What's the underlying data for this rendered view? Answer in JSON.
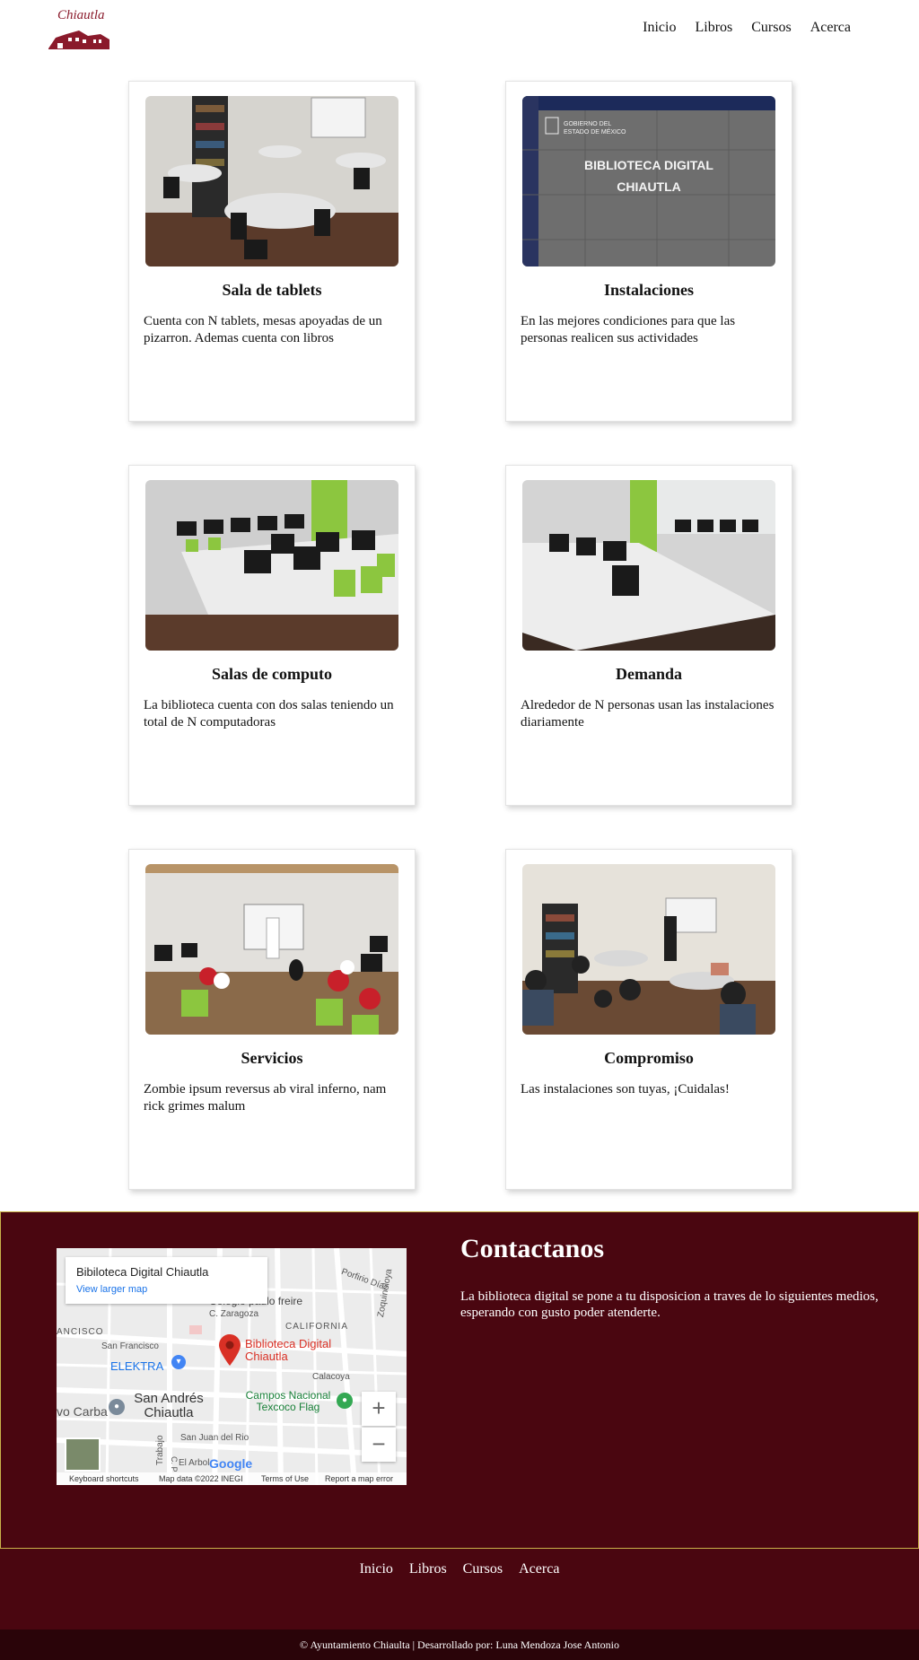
{
  "header": {
    "logo_text": "Chiautla",
    "nav": [
      "Inicio",
      "Libros",
      "Cursos",
      "Acerca"
    ]
  },
  "cards": [
    {
      "title": "Sala de tablets",
      "text": "Cuenta con N tablets, mesas apoyadas de un pizarron. Ademas cuenta con libros"
    },
    {
      "title": "Instalaciones",
      "text": "En las mejores condiciones para que las personas realicen sus actividades",
      "sign_line1": "GOBIERNO DEL",
      "sign_line2": "ESTADO DE MÉXICO",
      "sign_line3": "BIBLIOTECA DIGITAL",
      "sign_line4": "CHIAUTLA"
    },
    {
      "title": "Salas de computo",
      "text": "La biblioteca cuenta con dos salas teniendo un total de N computadoras"
    },
    {
      "title": "Demanda",
      "text": "Alrededor de N personas usan las instalaciones diariamente"
    },
    {
      "title": "Servicios",
      "text": "Zombie ipsum reversus ab viral inferno, nam rick grimes malum"
    },
    {
      "title": "Compromiso",
      "text": "Las instalaciones son tuyas, ¡Cuidalas!"
    }
  ],
  "contact": {
    "title": "Contactanos",
    "description": "La biblioteca digital se pone a tu disposicion a traves de lo siguientes medios, esperando con gusto poder atenderte.",
    "map": {
      "place_name": "Bibiloteca Digital Chiautla",
      "larger_map_link": "View larger map",
      "pin_label": "Biblioteca Digital Chiautla",
      "labels": {
        "colegio": "Colegio paulo freire",
        "zaragoza": "C. Zaragoza",
        "porfirio": "Porfirio Díaz",
        "california": "CALIFORNIA",
        "francisco_left": "ANCISCO",
        "san_francisco": "San Francisco",
        "elektra": "ELEKTRA",
        "calacoya": "Calacoya",
        "zoquinoloya": "Zoquinoloya",
        "carba": "vo Carba",
        "san_andres": "San Andrés Chiautla",
        "campos": "Campos Nacional Texcoco Flag",
        "juan_rio": "San Juan del Rio",
        "trabajo": "Trabajo",
        "el_arbol": "El Arbol",
        "c_p": "C. P"
      },
      "zoom_in": "+",
      "zoom_out": "−",
      "google": "Google",
      "footer": [
        "Keyboard shortcuts",
        "Map data ©2022 INEGI",
        "Terms of Use",
        "Report a map error"
      ]
    }
  },
  "footer": {
    "nav": [
      "Inicio",
      "Libros",
      "Cursos",
      "Acerca"
    ],
    "copyright": "© Ayuntamiento Chiaulta | Desarrollado por: Luna Mendoza Jose Antonio"
  },
  "colors": {
    "brand_dark": "#4a0610",
    "brand_darker": "#2a0409",
    "logo": "#8a1a2b",
    "map_pin": "#d93025",
    "map_link": "#1a73e8"
  }
}
